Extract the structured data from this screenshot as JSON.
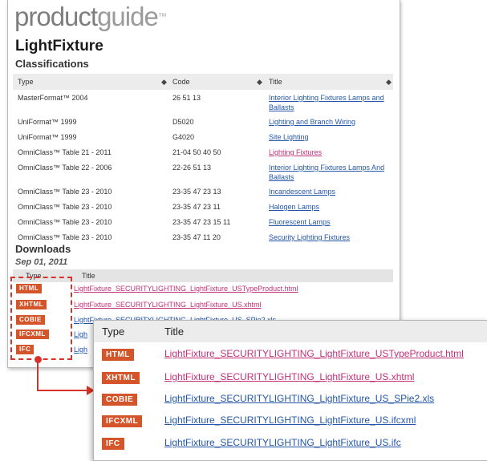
{
  "logo": {
    "bold": "product",
    "light": "guide",
    "tm": "™"
  },
  "page_title": "LightFixture",
  "classifications": {
    "heading": "Classifications",
    "columns": [
      "Type",
      "Code",
      "Title"
    ],
    "sort_icon": "◆",
    "rows": [
      {
        "type": "MasterFormat™ 2004",
        "code": "26 51 13",
        "title": "Interior Lighting Fixtures Lamps and Ballasts"
      },
      {
        "type": "UniFormat™ 1999",
        "code": "D5020",
        "title": "Lighting and Branch Wiring"
      },
      {
        "type": "UniFormat™ 1999",
        "code": "G4020",
        "title": "Site Lighting"
      },
      {
        "type": "OmniClass™ Table 21 - 2011",
        "code": "21-04 50 40 50",
        "title": "Lighting Fixtures"
      },
      {
        "type": "OmniClass™ Table 22 - 2006",
        "code": "22-26 51 13",
        "title": "Interior Lighting Fixtures Lamps And Ballasts"
      },
      {
        "type": "OmniClass™ Table 23 - 2010",
        "code": "23-35 47 23 13",
        "title": "Incandescent Lamps"
      },
      {
        "type": "OmniClass™ Table 23 - 2010",
        "code": "23-35 47 23 11",
        "title": "Halogen Lamps"
      },
      {
        "type": "OmniClass™ Table 23 - 2010",
        "code": "23-35 47 23 15 11",
        "title": "Fluorescent Lamps"
      },
      {
        "type": "OmniClass™ Table 23 - 2010",
        "code": "23-35 47 11 20",
        "title": "Security Lighting Fixtures"
      }
    ]
  },
  "downloads": {
    "heading": "Downloads",
    "date": "Sep 01, 2011",
    "columns": [
      "Type",
      "Title"
    ],
    "items": [
      {
        "badge": "HTML",
        "title": "LightFixture_SECURITYLIGHTING_LightFixture_USTypeProduct.html"
      },
      {
        "badge": "XHTML",
        "title": "LightFixture_SECURITYLIGHTING_LightFixture_US.xhtml"
      },
      {
        "badge": "COBIE",
        "title": "LightFixture_SECURITYLIGHTING_LightFixture_US_SPie2.xls"
      },
      {
        "badge": "IFCXML",
        "title": "LightFixture_SECURITYLIGHTING_LightFixture_US.ifcxml"
      },
      {
        "badge": "IFC",
        "title": "LightFixture_SECURITYLIGHTING_LightFixture_US.ifc"
      }
    ],
    "partial_titles": [
      "LightFixture_SECURITYLIGHTING_LightFixture_US_SPie2.xls",
      "Ligh",
      "Ligh"
    ]
  },
  "zoom": {
    "columns": [
      "Type",
      "Title"
    ]
  },
  "colors": {
    "badge": "#d4552a",
    "link": "#2356a8",
    "visited_link": "#c2307a",
    "callout": "#d8322a"
  }
}
